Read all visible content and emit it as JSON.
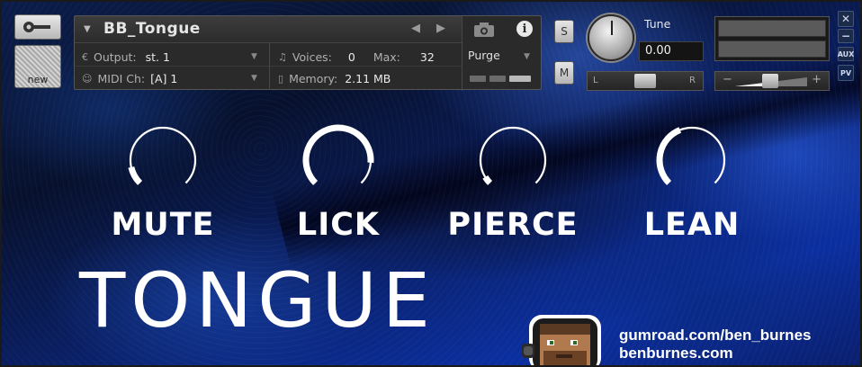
{
  "header": {
    "new_label": "new",
    "instrument_name": "BB_Tongue",
    "output_label": "Output:",
    "output_value": "st. 1",
    "midi_label": "MIDI Ch:",
    "midi_value": "[A]  1",
    "voices_label": "Voices:",
    "voices_value": "0",
    "max_label": "Max:",
    "max_value": "32",
    "memory_label": "Memory:",
    "memory_value": "2.11 MB",
    "purge_label": "Purge",
    "info_label": "i",
    "solo_label": "S",
    "mute_label": "M",
    "tune_label": "Tune",
    "tune_value": "0.00",
    "pan_left": "L",
    "pan_right": "R",
    "vol_minus": "−",
    "vol_plus": "+",
    "close_label": "✕",
    "min_label": "−",
    "aux_label": "AUX",
    "pv_label": "PV"
  },
  "knobs": [
    {
      "label": "MUTE",
      "level": 0.12
    },
    {
      "label": "LICK",
      "level": 0.85
    },
    {
      "label": "PIERCE",
      "level": 0.05
    },
    {
      "label": "LEAN",
      "level": 0.42
    }
  ],
  "title": "TONGUE",
  "credits": {
    "line1": "gumroad.com/ben_burnes",
    "line2": "benburnes.com"
  },
  "colors": {
    "background": "#0b2fa0",
    "knob_arc": "#ffffff"
  }
}
